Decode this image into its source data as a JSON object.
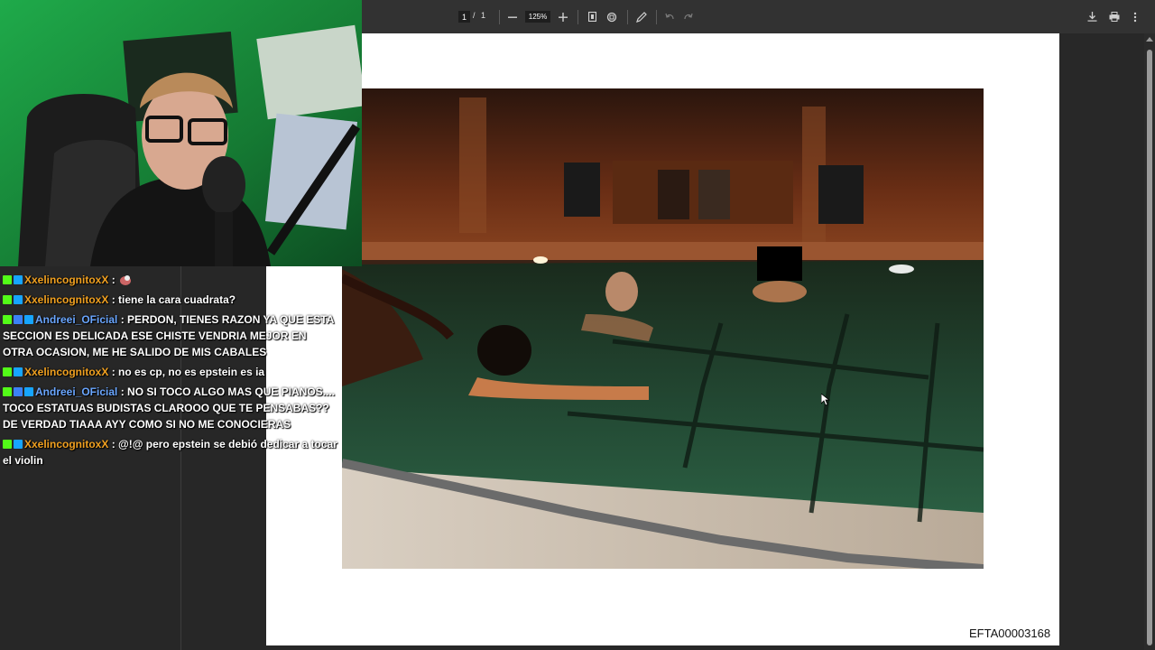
{
  "toolbar": {
    "page_current": "1",
    "page_separator": "/",
    "page_total": "1",
    "zoom": "125%",
    "icons": [
      "zoom-out-icon",
      "zoom-in-icon",
      "fit-page-icon",
      "rotate-icon",
      "annotate-icon",
      "undo-icon",
      "redo-icon",
      "download-icon",
      "print-icon",
      "more-icon"
    ]
  },
  "document": {
    "footer_code": "EFTA00003168"
  },
  "chat": {
    "messages": [
      {
        "user": "XxelincognitoxX",
        "user_color": "#f0a020",
        "badges": [
          "kick",
          "sub"
        ],
        "text": ":",
        "emote": true
      },
      {
        "user": "XxelincognitoxX",
        "user_color": "#f0a020",
        "badges": [
          "kick",
          "sub"
        ],
        "text": ": tiene la cara cuadrata?"
      },
      {
        "user": "Andreei_OFicial",
        "user_color": "#6aa6ff",
        "badges": [
          "kick",
          "prime",
          "sub"
        ],
        "text": ": PERDON, TIENES RAZON YA QUE ESTA SECCION ES DELICADA ESE CHISTE VENDRIA MEJOR EN OTRA OCASION, ME HE SALIDO DE MIS CABALES"
      },
      {
        "user": "XxelincognitoxX",
        "user_color": "#f0a020",
        "badges": [
          "kick",
          "sub"
        ],
        "text": ": no es cp, no es epstein es ia"
      },
      {
        "user": "Andreei_OFicial",
        "user_color": "#6aa6ff",
        "badges": [
          "kick",
          "prime",
          "sub"
        ],
        "text": ": NO SI TOCO ALGO MAS QUE PIANOS.... TOCO ESTATUAS BUDISTAS CLAROOO QUE TE PENSABAS?? DE VERDAD TIAAA AYY COMO SI NO ME CONOCIERAS"
      },
      {
        "user": "XxelincognitoxX",
        "user_color": "#f0a020",
        "badges": [
          "kick",
          "sub"
        ],
        "text": ": @!@ pero epstein se debió dedicar a tocar el violin"
      }
    ]
  },
  "colors": {
    "toolbar_bg": "#323232",
    "viewer_bg": "#282828",
    "chat_bg": "#272727",
    "webcam_bg": "#1f7a35"
  }
}
